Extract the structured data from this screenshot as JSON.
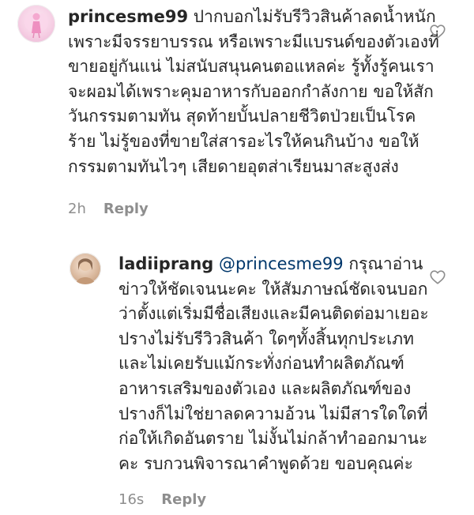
{
  "comments": [
    {
      "username": "princesme99",
      "text": "ปากบอกไม่รับรีวิวสินค้าลดน้ำหนัก เพราะมีจรรยาบรรณ หรือเพราะมีแบรนด์ของตัวเองที่ขายอยู่กันแน่ ไม่สนับสนุนคนตอแหลค่ะ รู้ทั้งรู้คนเราจะผอมได้เพราะคุมอาหารกับออกกำลังกาย ขอให้สักวันกรรมตามทัน สุดท้ายบั้นปลายชีวิตป่วยเป็นโรคร้าย ไม่รู้ของที่ขายใส่สารอะไรให้คนกินบ้าง ขอให้กรรมตามทันไวๆ เสียดายอุตส่าเรียนมาสะสูงส่ง",
      "time": "2h",
      "reply_label": "Reply",
      "avatar_icon": "fairy-avatar",
      "like_icon": "heart-outline-icon"
    },
    {
      "username": "ladiiprang",
      "mention": "@princesme99",
      "text": "กรุณาอ่านข่าวให้ชัดเจนนะคะ ให้สัมภาษณ์ชัดเจนบอกว่าตั้งแต่เริ่มมีชื่อเสียงและมีคนติดต่อมาเยอะ ปรางไม่รับรีวิวสินค้า ใดๆทั้งสิ้นทุกประเภท และไม่เคยรับแม้กระทั่งก่อนทำผลิตภัณฑ์อาหารเสริมของตัวเอง และผลิตภัณฑ์ของปรางก็ไม่ใช่ยาลดความอ้วน ไม่มีสารใดใดที่ก่อให้เกิดอันตราย ไม่งั้นไม่กล้าทำออกมานะคะ รบกวนพิจารณาคำพูดด้วย ขอบคุณค่ะ",
      "time": "16s",
      "reply_label": "Reply",
      "avatar_icon": "profile-photo-avatar",
      "like_icon": "heart-outline-icon"
    }
  ],
  "colors": {
    "text": "#262626",
    "meta": "#8e8e8e",
    "mention": "#00376b"
  }
}
